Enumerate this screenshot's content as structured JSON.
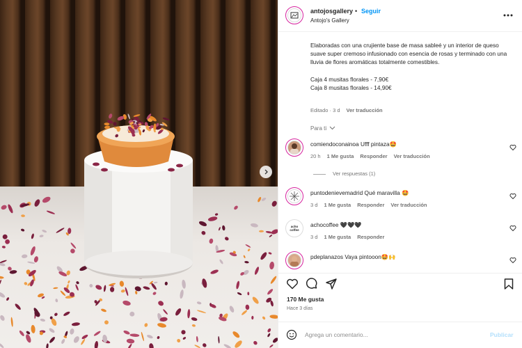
{
  "post": {
    "username": "antojosgallery",
    "separator": "•",
    "follow_label": "Seguir",
    "subtitle": "Antojo's Gallery",
    "caption_p1": "Elaboradas con una crujiente base de masa sableé y un interior de queso suave super cremoso infusionado con esencia de rosas y terminado con una lluvia de flores aromáticas totalmente comestibles.",
    "caption_p2": "Caja 4 musitas florales - 7,90€",
    "caption_p3": "Caja 8 musitas florales - 14,90€",
    "edited": "Editado · 3 d",
    "see_translation": "Ver traducción",
    "for_you": "Para ti"
  },
  "comments": [
    {
      "user": "comiendoconainoa",
      "text": "Ufff pintaza🤩",
      "time": "20 h",
      "likes": "1 Me gusta",
      "reply": "Responder",
      "translate": "Ver traducción",
      "avatar": "photo-avatar",
      "view_replies": "Ver respuestas (1)"
    },
    {
      "user": "puntodenievemadrid",
      "text": "Qué maravilla 🤩",
      "time": "3 d",
      "likes": "1 Me gusta",
      "reply": "Responder",
      "translate": "Ver traducción",
      "avatar": "snowflake-logo"
    },
    {
      "user": "achocoffee",
      "text": "🖤🖤🖤",
      "time": "3 d",
      "likes": "1 Me gusta",
      "reply": "Responder",
      "avatar": "coffee-logo",
      "avatar_text": "acho coffee"
    },
    {
      "user": "pdeplanazos",
      "text": "Vaya pintooon🤩🙌",
      "avatar": "photo-avatar"
    }
  ],
  "footer": {
    "likes": "170 Me gusta",
    "date": "Hace 3 días",
    "comment_placeholder": "Agrega un comentario...",
    "publish_label": "Publicar"
  },
  "colors": {
    "accent": "#0095f6",
    "ring": "#d6249f",
    "muted": "#737373"
  },
  "icons": [
    "more-icon",
    "heart-icon",
    "comment-icon",
    "share-icon",
    "bookmark-icon",
    "emoji-icon",
    "chevron-right-icon",
    "chevron-down-icon"
  ]
}
